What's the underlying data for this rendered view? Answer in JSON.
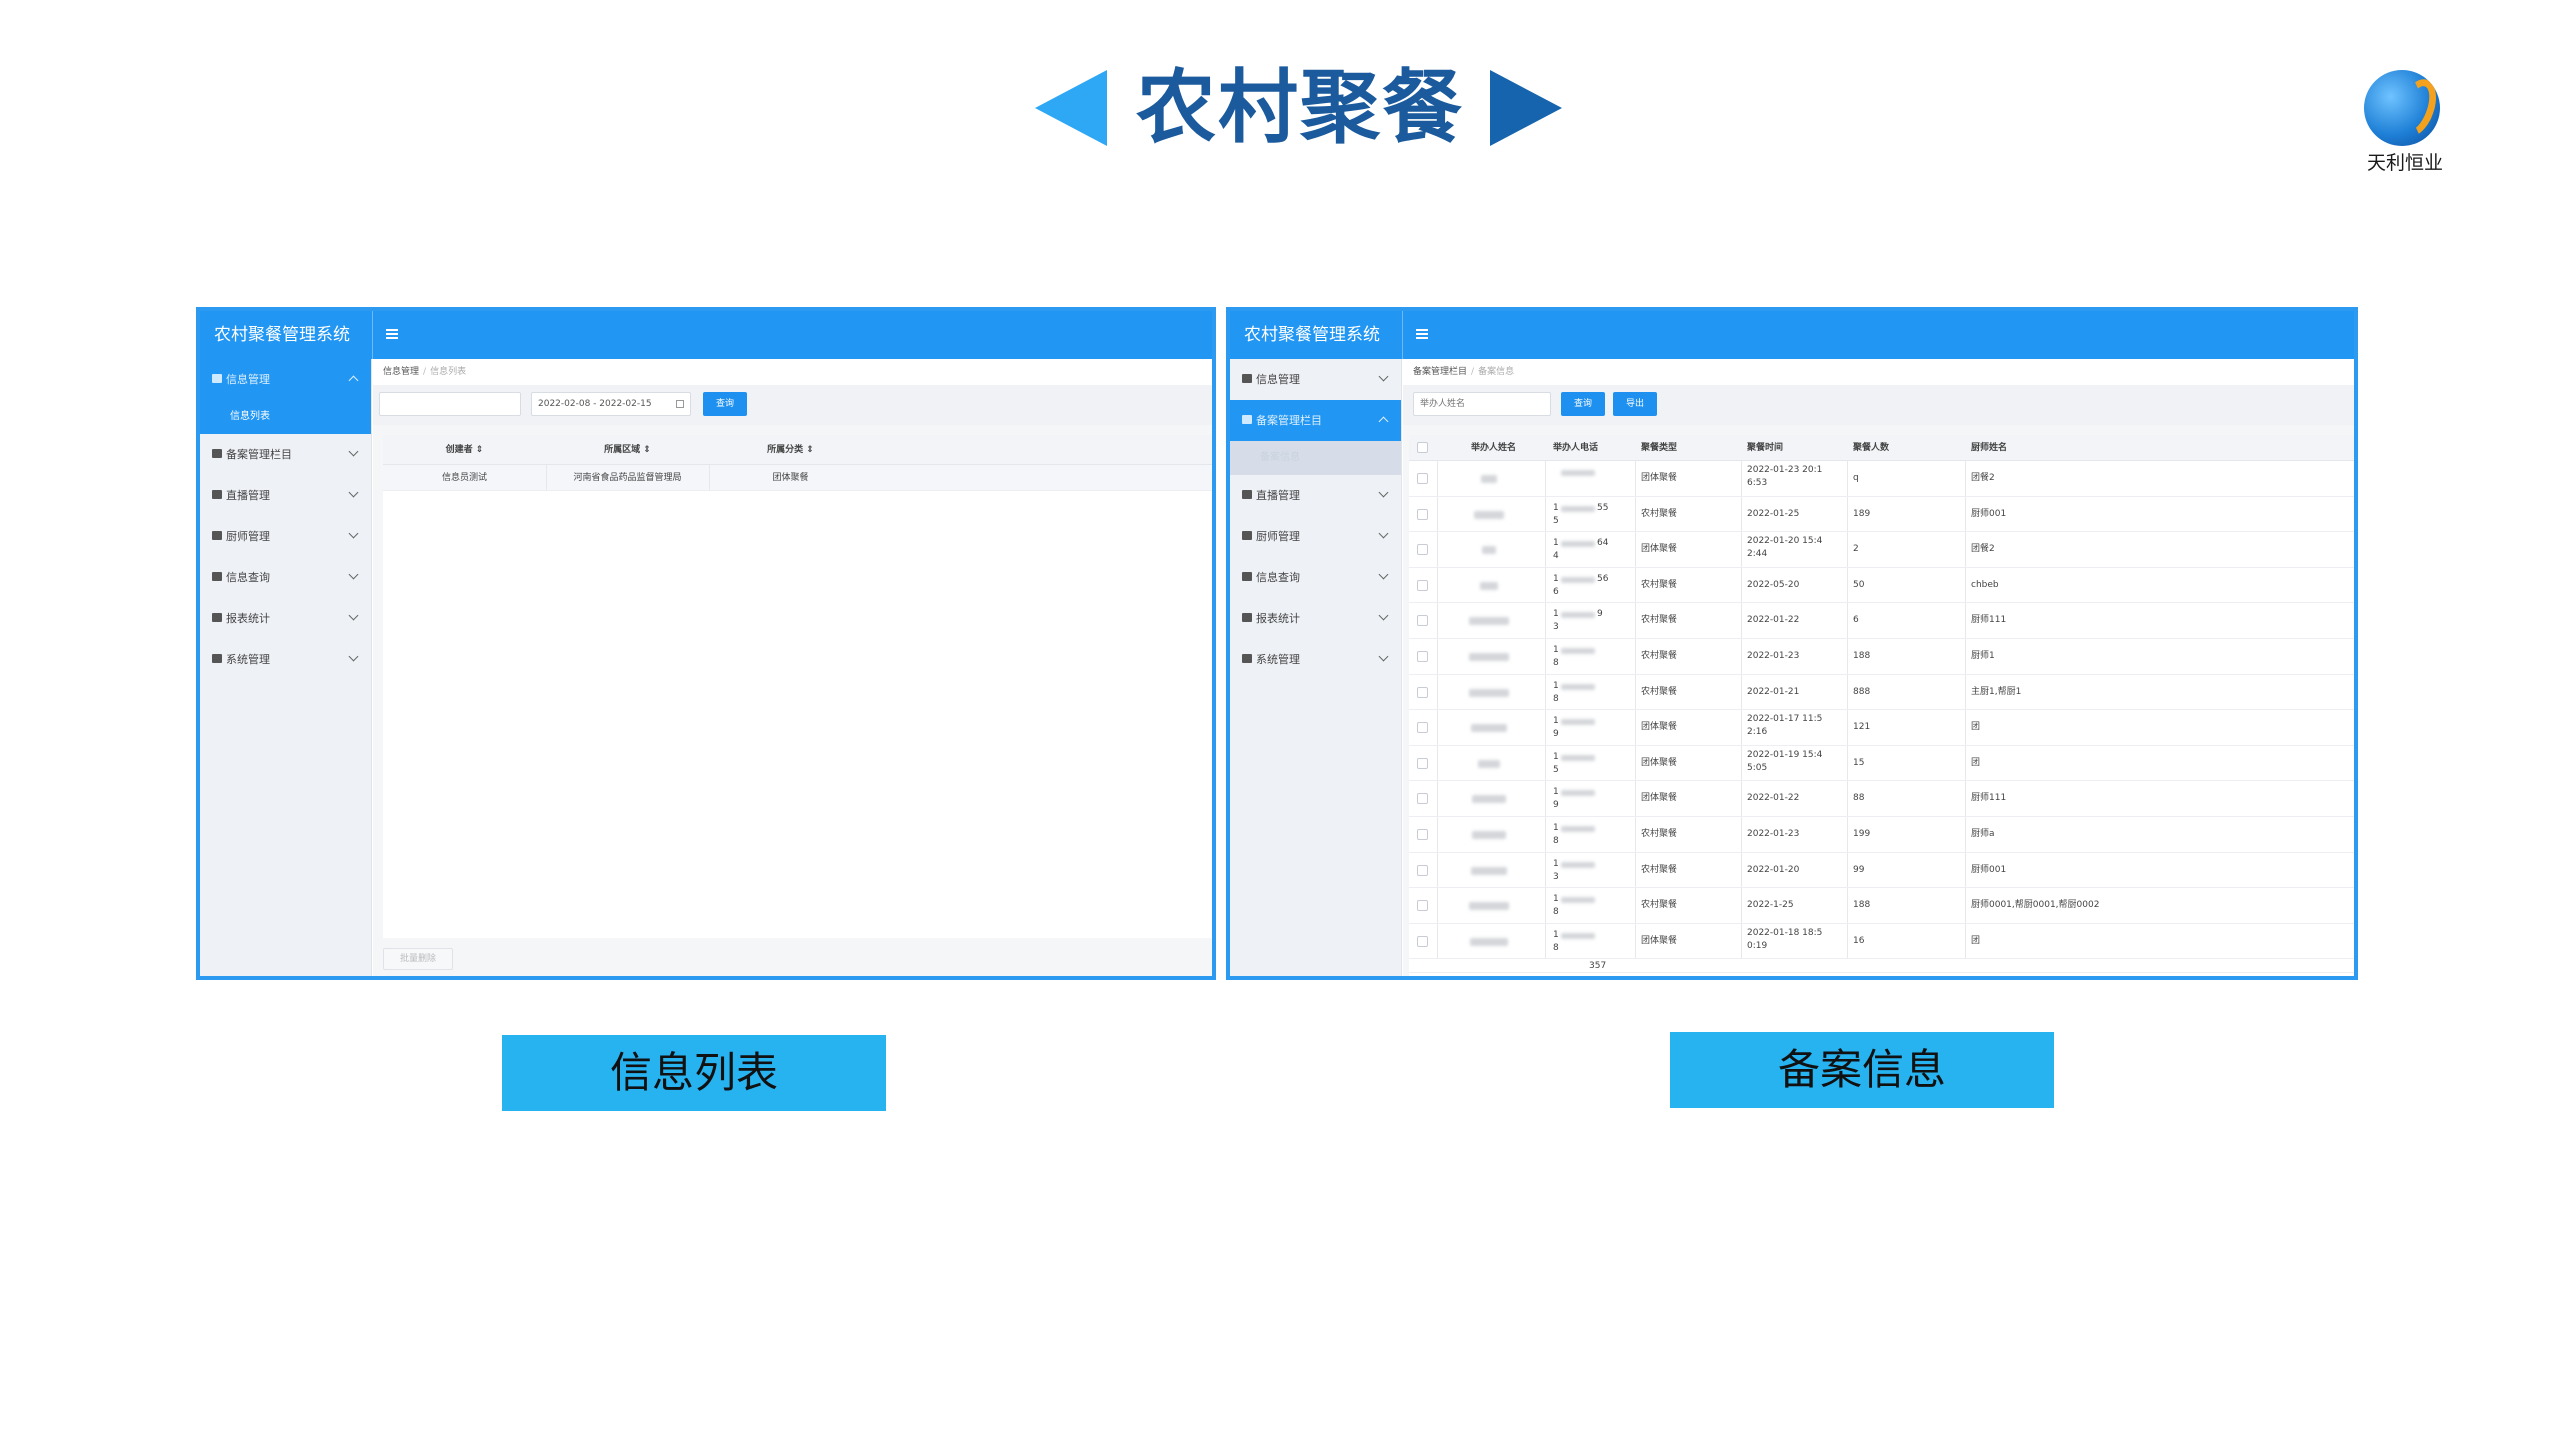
{
  "slide": {
    "title": "农村聚餐",
    "logo_text": "天利恒业",
    "colors": {
      "accent_blue": "#2196f3",
      "title_blue": "#1b5a9c",
      "caption_blue": "#27b2f0",
      "arrow_left": "#2ea8f5",
      "arrow_right": "#1564ad"
    }
  },
  "left_panel": {
    "app_title": "农村聚餐管理系统",
    "menu_icon": "hamburger-icon",
    "sidebar": {
      "items": [
        {
          "label": "信息管理",
          "icon": "envelope-icon",
          "active": true,
          "expanded": true
        },
        {
          "label": "备案管理栏目",
          "icon": "table-icon"
        },
        {
          "label": "直播管理",
          "icon": "eye-icon"
        },
        {
          "label": "厨师管理",
          "icon": "table-icon"
        },
        {
          "label": "信息查询",
          "icon": "target-icon"
        },
        {
          "label": "报表统计",
          "icon": "chart-icon"
        },
        {
          "label": "系统管理",
          "icon": "gear-icon"
        }
      ],
      "sub_item": "信息列表"
    },
    "breadcrumb": [
      "信息管理",
      "信息列表"
    ],
    "search": {
      "text_value": "",
      "date_range": "2022-02-08 - 2022-02-15",
      "button": "查询"
    },
    "table": {
      "headers": [
        "创建者",
        "所属区域",
        "所属分类"
      ],
      "rows": [
        [
          "信息员测试",
          "河南省食品药品监督管理局",
          "团体聚餐"
        ]
      ]
    },
    "footer_button": "批量删除"
  },
  "right_panel": {
    "app_title": "农村聚餐管理系统",
    "sidebar": {
      "items": [
        {
          "label": "信息管理",
          "icon": "envelope-icon"
        },
        {
          "label": "备案管理栏目",
          "icon": "table-icon",
          "active": true,
          "expanded": true
        },
        {
          "label": "直播管理",
          "icon": "eye-icon"
        },
        {
          "label": "厨师管理",
          "icon": "table-icon"
        },
        {
          "label": "信息查询",
          "icon": "target-icon"
        },
        {
          "label": "报表统计",
          "icon": "chart-icon"
        },
        {
          "label": "系统管理",
          "icon": "gear-icon"
        }
      ],
      "sub_item": "备案信息"
    },
    "breadcrumb": [
      "备案管理栏目",
      "备案信息"
    ],
    "search": {
      "placeholder": "举办人姓名",
      "button": "查询",
      "export_button": "导出"
    },
    "table": {
      "headers": [
        "举办人姓名",
        "举办人电话",
        "聚餐类型",
        "聚餐时间",
        "聚餐人数",
        "厨师姓名"
      ],
      "rows": [
        {
          "phone": [
            "",
            ""
          ],
          "type": "团体聚餐",
          "time": [
            "2022-01-23 20:1",
            "6:53"
          ],
          "count": "q",
          "chef": "团餐2"
        },
        {
          "phone": [
            "1",
            "55",
            "5"
          ],
          "type": "农村聚餐",
          "time": [
            "2022-01-25"
          ],
          "count": "189",
          "chef": "厨师001"
        },
        {
          "phone": [
            "1",
            "64",
            "4"
          ],
          "type": "团体聚餐",
          "time": [
            "2022-01-20 15:4",
            "2:44"
          ],
          "count": "2",
          "chef": "团餐2"
        },
        {
          "phone": [
            "1",
            "56",
            "6"
          ],
          "type": "农村聚餐",
          "time": [
            "2022-05-20"
          ],
          "count": "50",
          "chef": "chbeb"
        },
        {
          "phone": [
            "1",
            "9",
            "3"
          ],
          "type": "农村聚餐",
          "time": [
            "2022-01-22"
          ],
          "count": "6",
          "chef": "厨师111"
        },
        {
          "phone": [
            "1",
            "",
            "8"
          ],
          "type": "农村聚餐",
          "time": [
            "2022-01-23"
          ],
          "count": "188",
          "chef": "厨师1"
        },
        {
          "phone": [
            "1",
            "",
            "8"
          ],
          "type": "农村聚餐",
          "time": [
            "2022-01-21"
          ],
          "count": "888",
          "chef": "主厨1,帮厨1"
        },
        {
          "phone": [
            "1",
            "",
            "9"
          ],
          "type": "团体聚餐",
          "time": [
            "2022-01-17 11:5",
            "2:16"
          ],
          "count": "121",
          "chef": "团"
        },
        {
          "phone": [
            "1",
            "",
            "5"
          ],
          "type": "团体聚餐",
          "time": [
            "2022-01-19 15:4",
            "5:05"
          ],
          "count": "15",
          "chef": "团"
        },
        {
          "phone": [
            "1",
            "",
            "9"
          ],
          "type": "团体聚餐",
          "time": [
            "2022-01-22"
          ],
          "count": "88",
          "chef": "厨师111"
        },
        {
          "phone": [
            "1",
            "",
            "8"
          ],
          "type": "农村聚餐",
          "time": [
            "2022-01-23"
          ],
          "count": "199",
          "chef": "厨师a"
        },
        {
          "phone": [
            "1",
            "",
            "3"
          ],
          "type": "农村聚餐",
          "time": [
            "2022-01-20"
          ],
          "count": "99",
          "chef": "厨师001"
        },
        {
          "phone": [
            "1",
            "",
            "8"
          ],
          "type": "农村聚餐",
          "time": [
            "2022-1-25"
          ],
          "count": "188",
          "chef": "厨师0001,帮厨0001,帮厨0002"
        },
        {
          "phone": [
            "1",
            "",
            "8"
          ],
          "type": "团体聚餐",
          "time": [
            "2022-01-18 18:5",
            "0:19"
          ],
          "count": "16",
          "chef": "团"
        }
      ],
      "partial_row_phone": "357"
    }
  },
  "captions": {
    "left": "信息列表",
    "right": "备案信息"
  }
}
